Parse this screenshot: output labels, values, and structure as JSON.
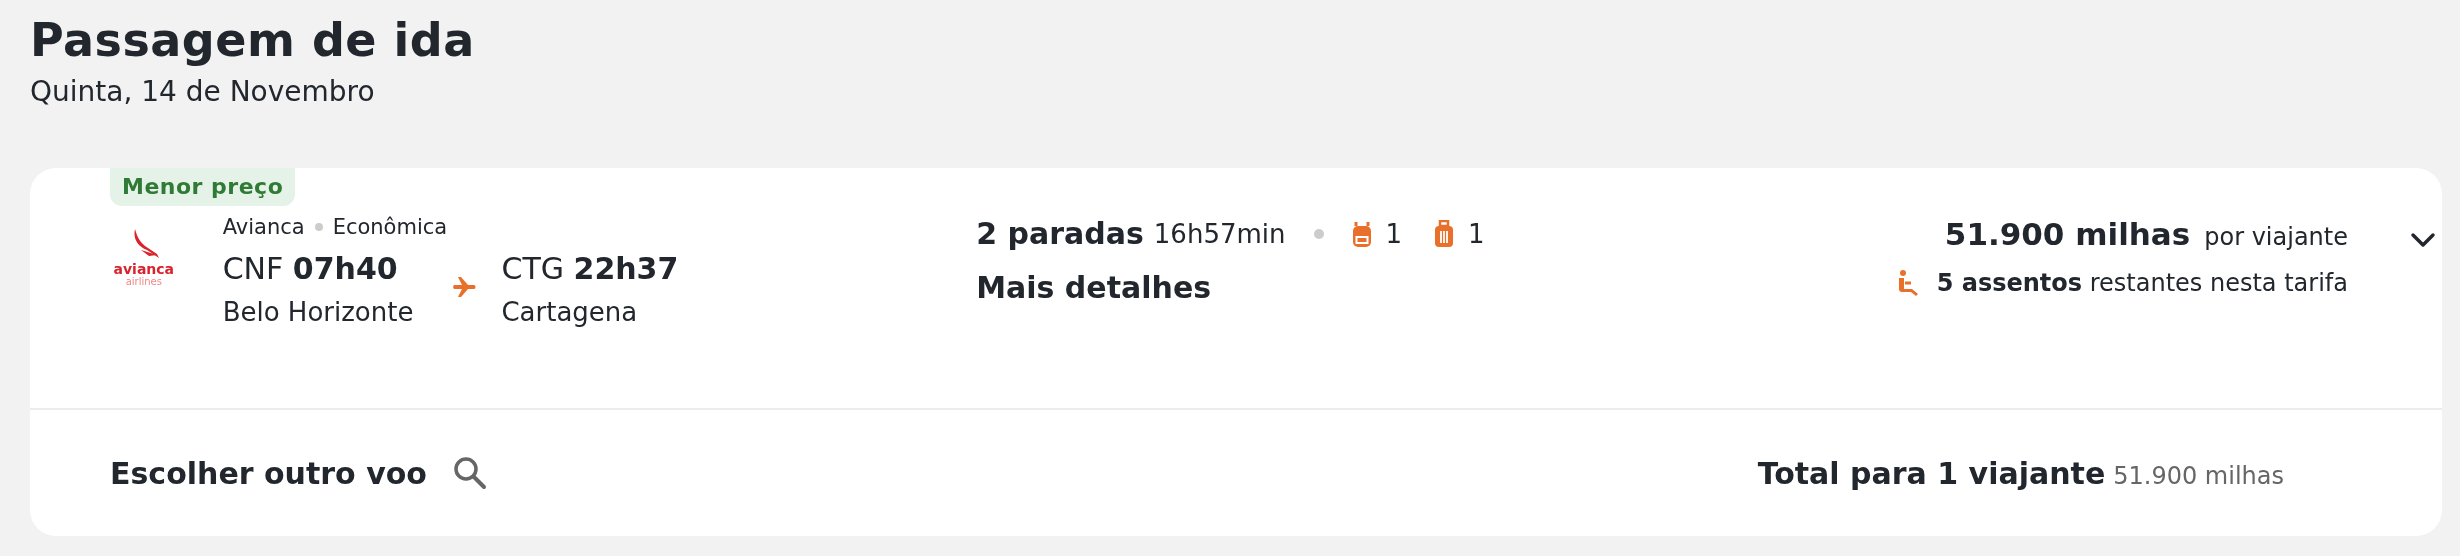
{
  "header": {
    "title": "Passagem de ida",
    "subtitle": "Quinta, 14 de Novembro"
  },
  "flight": {
    "badge": "Menor preço",
    "logo": {
      "name": "avianca",
      "tagline": "airlines"
    },
    "airline": "Avianca",
    "cabin": "Econômica",
    "departure": {
      "code": "CNF",
      "time": "07h40",
      "city": "Belo Horizonte"
    },
    "arrival": {
      "code": "CTG",
      "time": "22h37",
      "city": "Cartagena"
    },
    "stops": "2 paradas",
    "duration": "16h57min",
    "baggage": [
      {
        "kind": "backpack",
        "count": "1"
      },
      {
        "kind": "suitcase",
        "count": "1"
      }
    ],
    "details_link": "Mais detalhes",
    "price": "51.900 milhas",
    "price_note": "por viajante",
    "seats": "**5 assentos** restantes nesta tarifa",
    "expanded": false
  },
  "footer": {
    "change_flight": "Escolher outro voo",
    "total_label": "Total para 1 viajante",
    "total_value": "51.900 milhas"
  }
}
